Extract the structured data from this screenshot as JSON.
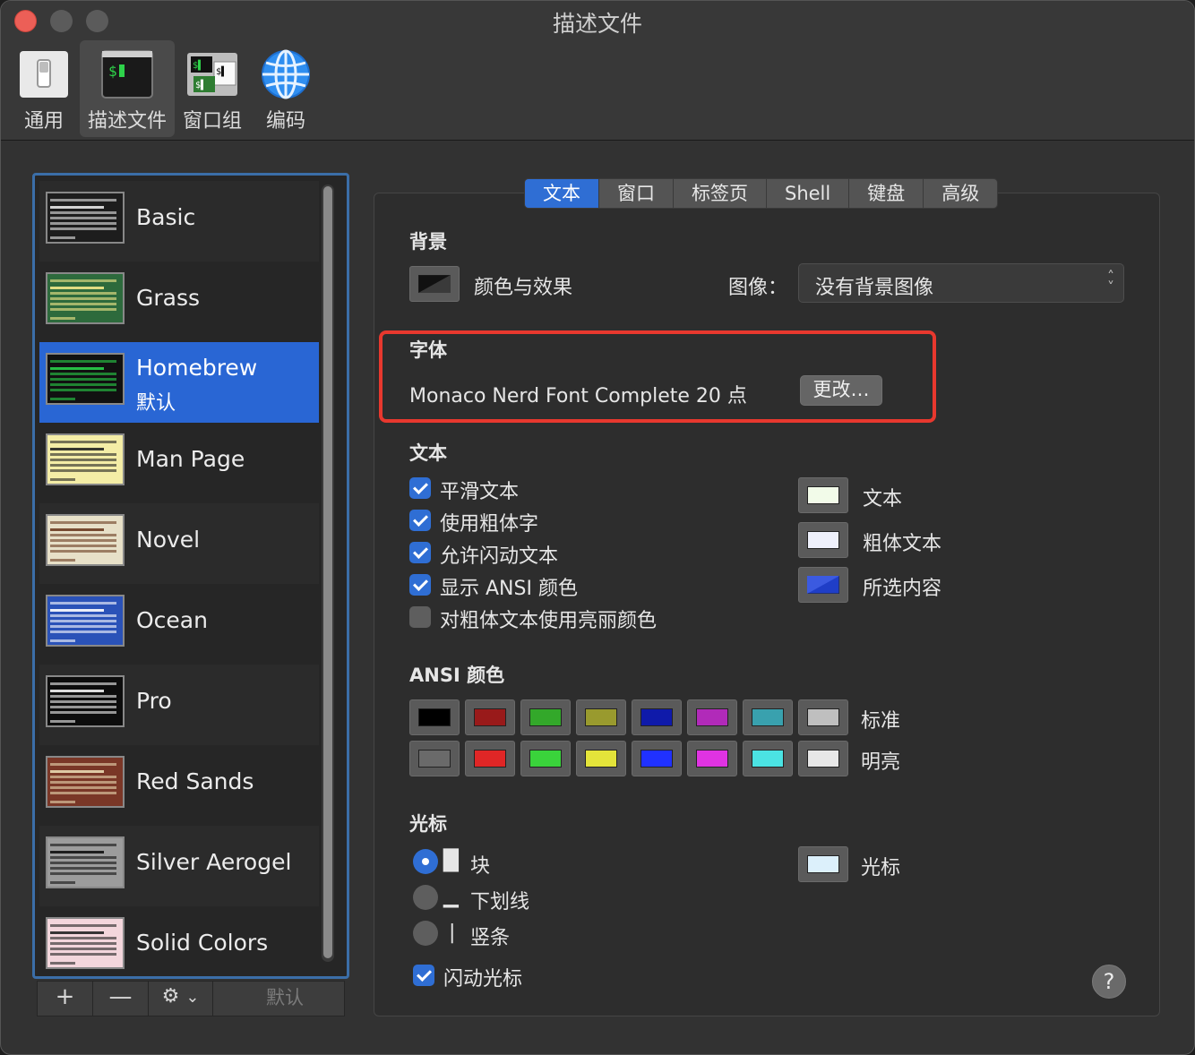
{
  "window": {
    "title": "描述文件"
  },
  "toolbar": {
    "items": [
      {
        "label": "通用"
      },
      {
        "label": "描述文件"
      },
      {
        "label": "窗口组"
      },
      {
        "label": "编码"
      }
    ]
  },
  "profiles": {
    "items": [
      {
        "name": "Basic",
        "thumb_bg": "#1d1d1d",
        "thumb_fg": "#e8e8e8"
      },
      {
        "name": "Grass",
        "thumb_bg": "#2d6a3c",
        "thumb_fg": "#f3e98a"
      },
      {
        "name": "Homebrew",
        "sub": "默认",
        "thumb_bg": "#111111",
        "thumb_fg": "#29d14a"
      },
      {
        "name": "Man Page",
        "thumb_bg": "#f4eda6",
        "thumb_fg": "#222222"
      },
      {
        "name": "Novel",
        "thumb_bg": "#e7e0c8",
        "thumb_fg": "#6b3b20"
      },
      {
        "name": "Ocean",
        "thumb_bg": "#2a52b8",
        "thumb_fg": "#ffffff"
      },
      {
        "name": "Pro",
        "thumb_bg": "#0d0d0d",
        "thumb_fg": "#f2f2f2"
      },
      {
        "name": "Red Sands",
        "thumb_bg": "#7a3727",
        "thumb_fg": "#e9d9b2"
      },
      {
        "name": "Silver Aerogel",
        "thumb_bg": "#9c9c9c",
        "thumb_fg": "#111111"
      },
      {
        "name": "Solid Colors",
        "thumb_bg": "#f3d6dc",
        "thumb_fg": "#222222"
      }
    ],
    "selected_index": 2,
    "bottom": {
      "add": "+",
      "remove": "—",
      "gear": "⚙",
      "gear_caret": "⌄",
      "default_label": "默认"
    }
  },
  "tabs": [
    {
      "label": "文本",
      "active": true
    },
    {
      "label": "窗口"
    },
    {
      "label": "标签页"
    },
    {
      "label": "Shell"
    },
    {
      "label": "键盘"
    },
    {
      "label": "高级"
    }
  ],
  "background": {
    "title": "背景",
    "color_effects_label": "颜色与效果",
    "image_label": "图像：",
    "image_value": "没有背景图像"
  },
  "font": {
    "title": "字体",
    "value": "Monaco Nerd Font Complete 20 点",
    "change_button": "更改…"
  },
  "text": {
    "title": "文本",
    "options": [
      {
        "label": "平滑文本",
        "checked": true
      },
      {
        "label": "使用粗体字",
        "checked": true
      },
      {
        "label": "允许闪动文本",
        "checked": true
      },
      {
        "label": "显示 ANSI 颜色",
        "checked": true
      },
      {
        "label": "对粗体文本使用亮丽颜色",
        "checked": false
      }
    ],
    "colors": [
      {
        "label": "文本",
        "color": "#f2fbe9"
      },
      {
        "label": "粗体文本",
        "color": "#eef0fb"
      },
      {
        "label": "所选内容",
        "color": "#1f3ec7"
      }
    ]
  },
  "ansi": {
    "title": "ANSI 颜色",
    "normal_label": "标准",
    "bright_label": "明亮",
    "normal": [
      "#000000",
      "#991a1a",
      "#33a82a",
      "#999a2e",
      "#0f1aaa",
      "#b12ab9",
      "#39a1ae",
      "#bfbfbf"
    ],
    "bright": [
      "#6a6a6a",
      "#e02626",
      "#3ad33b",
      "#e4e43a",
      "#2031ff",
      "#e033e2",
      "#4be3e3",
      "#e7e7e7"
    ]
  },
  "cursor": {
    "title": "光标",
    "options": [
      {
        "glyph": "█",
        "label": "块",
        "selected": true
      },
      {
        "glyph": "▁",
        "label": "下划线",
        "selected": false
      },
      {
        "glyph": "|",
        "label": "竖条",
        "selected": false
      }
    ],
    "blink_label": "闪动光标",
    "blink_checked": true,
    "color_label": "光标",
    "color": "#dcf0fb"
  },
  "help": "?"
}
